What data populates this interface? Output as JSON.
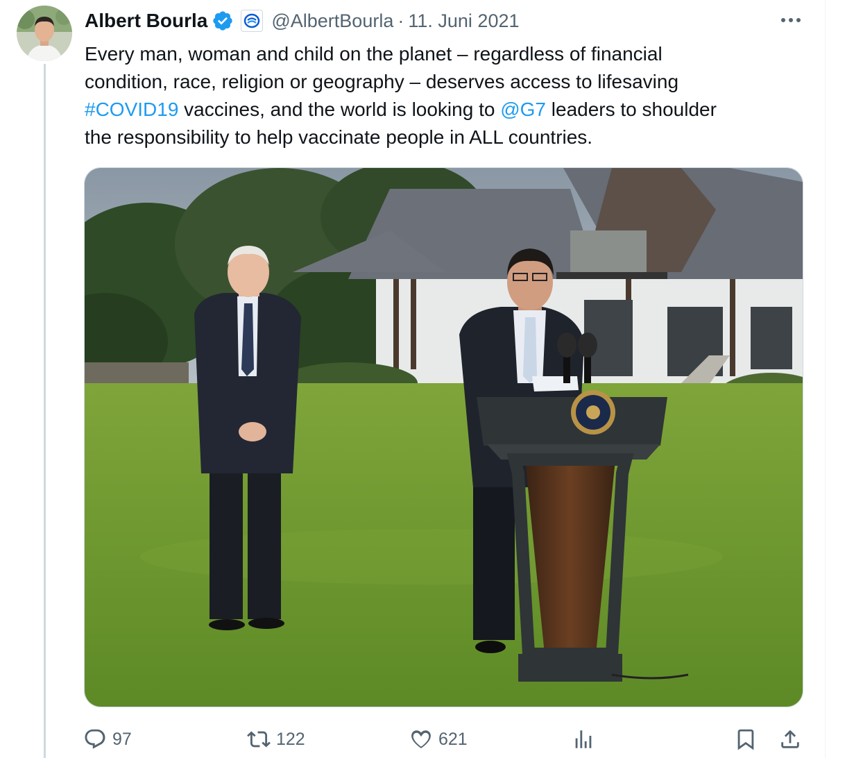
{
  "tweet": {
    "author_name": "Albert Bourla",
    "handle": "@AlbertBourla",
    "separator": "·",
    "date": "11. Juni 2021",
    "text_lines": [
      [
        {
          "t": "Every man, woman and child on the planet – regardless of financial",
          "link": false
        }
      ],
      [
        {
          "t": "condition, race, religion or geography – deserves access to lifesaving",
          "link": false
        }
      ],
      [
        {
          "t": "#COVID19",
          "link": true
        },
        {
          "t": " vaccines, and the world is looking to ",
          "link": false
        },
        {
          "t": "@G7",
          "link": true
        },
        {
          "t": " leaders to shoulder",
          "link": false
        }
      ],
      [
        {
          "t": "the responsibility to help vaccinate people in ALL countries.",
          "link": false
        }
      ]
    ]
  },
  "icons": {
    "verified": "verified-badge-icon",
    "affiliation": "affiliation-logo-icon",
    "more": "more-icon",
    "reply": "reply-icon",
    "retweet": "retweet-icon",
    "like": "like-icon",
    "views": "views-icon",
    "bookmark": "bookmark-icon",
    "share": "share-icon"
  },
  "actions": {
    "replies": "97",
    "retweets": "122",
    "likes": "621"
  },
  "colors": {
    "link": "#1d9bf0",
    "verified": "#1d9bf0",
    "secondary_text": "#536471",
    "text": "#0f1419"
  }
}
